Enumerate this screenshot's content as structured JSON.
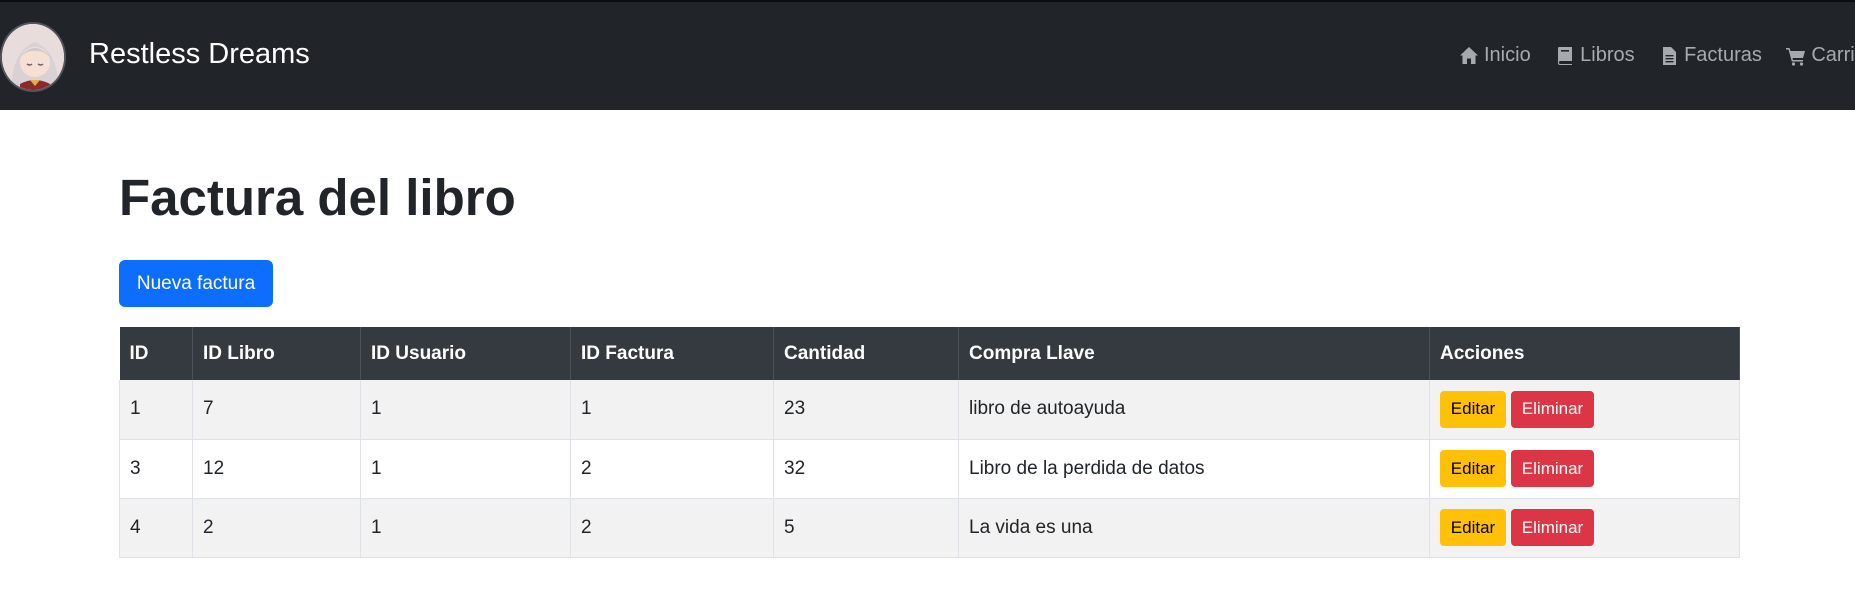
{
  "navbar": {
    "brand": "Restless Dreams",
    "links": [
      {
        "label": "Inicio",
        "icon": "home-icon"
      },
      {
        "label": "Libros",
        "icon": "book-icon"
      },
      {
        "label": "Facturas",
        "icon": "file-text-icon"
      },
      {
        "label": "Carrito",
        "icon": "cart-icon"
      }
    ]
  },
  "page": {
    "title": "Factura del libro",
    "new_button": "Nueva factura"
  },
  "table": {
    "headers": [
      "ID",
      "ID Libro",
      "ID Usuario",
      "ID Factura",
      "Cantidad",
      "Compra Llave",
      "Acciones"
    ],
    "rows": [
      {
        "id": "1",
        "id_libro": "7",
        "id_usuario": "1",
        "id_factura": "1",
        "cantidad": "23",
        "compra_llave": "libro de autoayuda"
      },
      {
        "id": "3",
        "id_libro": "12",
        "id_usuario": "1",
        "id_factura": "2",
        "cantidad": "32",
        "compra_llave": "Libro de la perdida de datos"
      },
      {
        "id": "4",
        "id_libro": "2",
        "id_usuario": "1",
        "id_factura": "2",
        "cantidad": "5",
        "compra_llave": "La vida es una"
      }
    ],
    "edit_label": "Editar",
    "delete_label": "Eliminar"
  },
  "colors": {
    "navbar_bg": "#212529",
    "primary": "#0d6efd",
    "warning": "#ffc107",
    "danger": "#dc3545",
    "table_header_bg": "#343a40"
  }
}
